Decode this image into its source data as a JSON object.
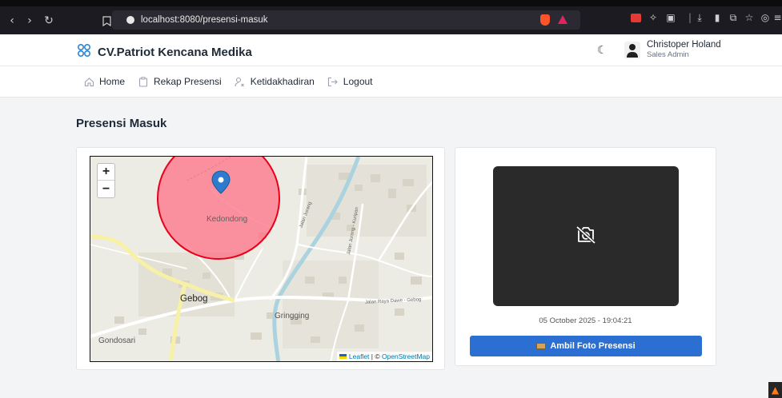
{
  "browser": {
    "url": "localhost:8080/presensi-masuk"
  },
  "header": {
    "brand": "CV.Patriot Kencana Medika",
    "user_name": "Christoper Holand",
    "user_role": "Sales Admin"
  },
  "nav": {
    "items": [
      {
        "label": "Home",
        "icon": "home-icon"
      },
      {
        "label": "Rekap Presensi",
        "icon": "clipboard-icon"
      },
      {
        "label": "Ketidakhadiran",
        "icon": "user-x-icon"
      },
      {
        "label": "Logout",
        "icon": "logout-icon"
      }
    ]
  },
  "page": {
    "title": "Presensi Masuk"
  },
  "map": {
    "zoom_in": "+",
    "zoom_out": "−",
    "labels": {
      "kedondong": "Kedondong",
      "gebog": "Gebog",
      "gringging": "Gringging",
      "gondosari": "Gondosari",
      "jalan_raya_dawe": "Jalan Raya Dawe - Gebog",
      "jalan_jurang": "Jalan Jurang",
      "jalan_jurang_kuripan": "Jalan Jurang - Kuripan"
    },
    "attribution_leaflet": "Leaflet",
    "attribution_sep": " | © ",
    "attribution_osm": "OpenStreetMap",
    "circle_color": "#ff6b81"
  },
  "camera": {
    "timestamp": "05 October 2025 - 19:04:21",
    "button_label": "Ambil Foto Presensi"
  },
  "colors": {
    "primary": "#2a6fd1",
    "camera_bg": "#2a2a2a"
  }
}
